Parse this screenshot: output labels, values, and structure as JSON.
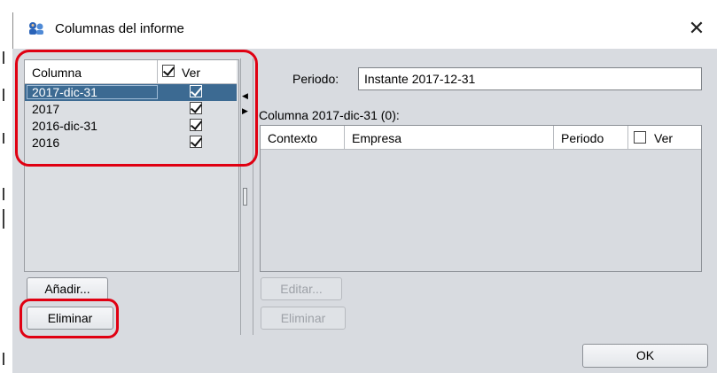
{
  "window": {
    "title": "Columnas del informe",
    "close_symbol": "✕"
  },
  "columns_list": {
    "header_column": "Columna",
    "header_show": "Ver",
    "header_show_checked": true,
    "rows": [
      {
        "label": "2017-dic-31",
        "checked": true,
        "selected": true
      },
      {
        "label": "2017",
        "checked": true,
        "selected": false
      },
      {
        "label": "2016-dic-31",
        "checked": true,
        "selected": false
      },
      {
        "label": "2016",
        "checked": true,
        "selected": false
      }
    ],
    "add_label": "Añadir...",
    "delete_label": "Eliminar"
  },
  "splitter": {
    "left_arrow": "◀",
    "right_arrow": "▶"
  },
  "detail": {
    "period_label": "Periodo:",
    "period_value": "Instante 2017-12-31",
    "column_title": "Columna 2017-dic-31 (0):",
    "context_table": {
      "headers": [
        "Contexto",
        "Empresa",
        "Periodo",
        "Ver"
      ],
      "show_checked": false
    },
    "edit_label": "Editar...",
    "delete_label": "Eliminar"
  },
  "footer": {
    "ok_label": "OK"
  },
  "colors": {
    "selection": "#3c6a92",
    "dialog_background": "#d8dbe0",
    "annotation": "#e00012"
  }
}
